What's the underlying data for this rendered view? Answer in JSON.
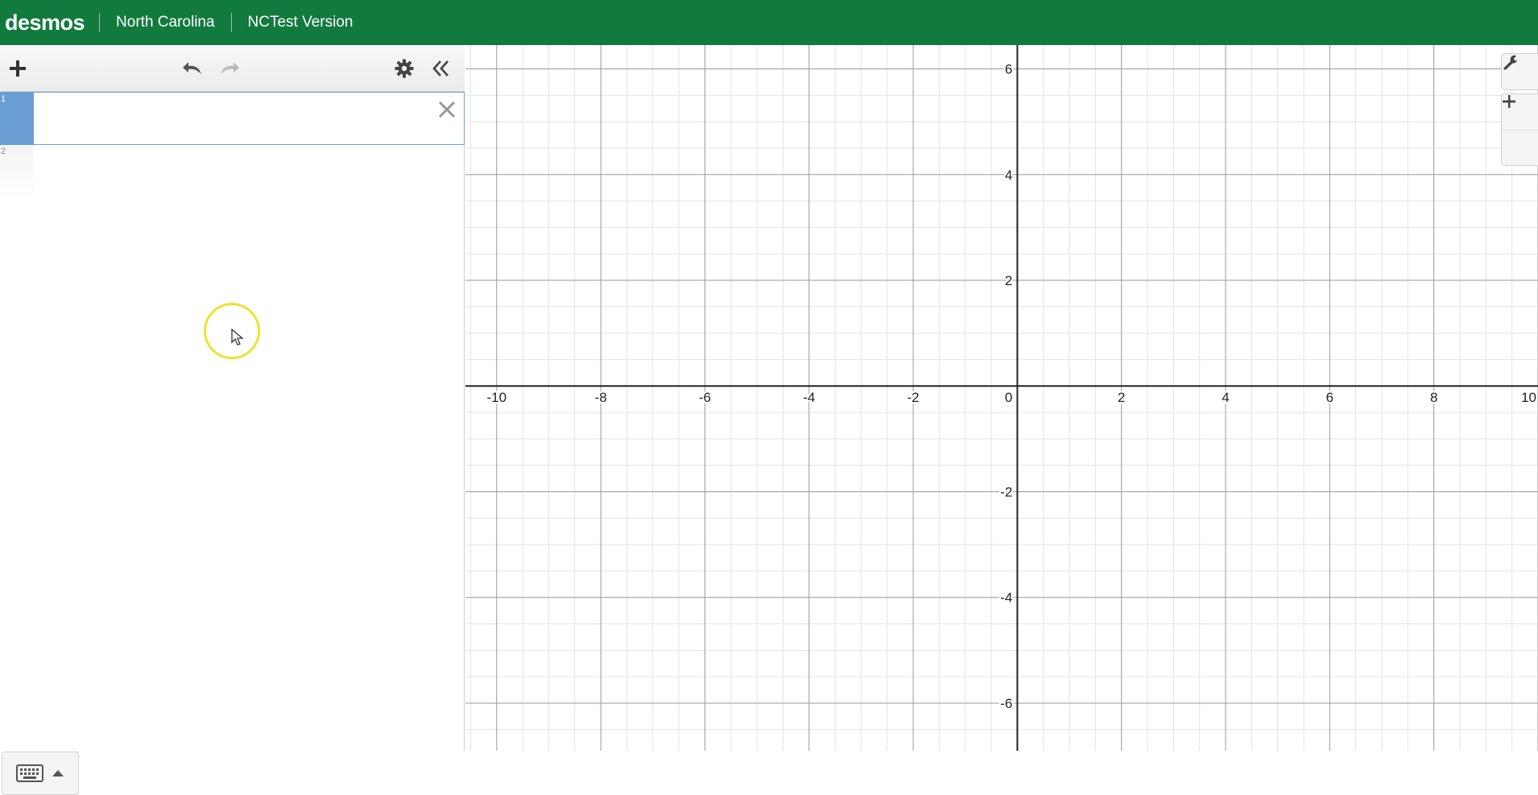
{
  "colors": {
    "brand": "#127a3d",
    "active_tab": "#6a9fd4",
    "cursor_ring": "#f0e130",
    "axis": "#222222",
    "major_grid": "#999999",
    "minor_grid": "#e3e3e3"
  },
  "header": {
    "logo": "desmos",
    "links": [
      "North Carolina",
      "NCTest Version"
    ]
  },
  "toolbar": {
    "icons": [
      "plus-icon",
      "undo-icon",
      "redo-icon",
      "gear-icon",
      "collapse-icon"
    ]
  },
  "expressions": [
    {
      "index": "1",
      "value": "",
      "active": true
    },
    {
      "index": "2",
      "value": "",
      "active": false
    }
  ],
  "keypad": {
    "icons": [
      "keyboard-icon",
      "caret-up-icon"
    ]
  },
  "graph_controls": {
    "icons": [
      "wrench-icon",
      "zoom-in-icon",
      "zoom-out-icon"
    ]
  },
  "chart_data": {
    "type": "scatter",
    "title": "",
    "xlabel": "",
    "ylabel": "",
    "xlim": [
      -10.6,
      10
    ],
    "ylim": [
      -6.9,
      6.45
    ],
    "x_ticks": [
      "-10",
      "-8",
      "-6",
      "-4",
      "-2",
      "2",
      "4",
      "6",
      "8",
      "10"
    ],
    "y_ticks": [
      "6",
      "4",
      "2",
      "-2",
      "-4",
      "-6"
    ],
    "origin_label": "0",
    "major_step": 2,
    "minor_step": 0.5,
    "grid": true,
    "series": []
  }
}
